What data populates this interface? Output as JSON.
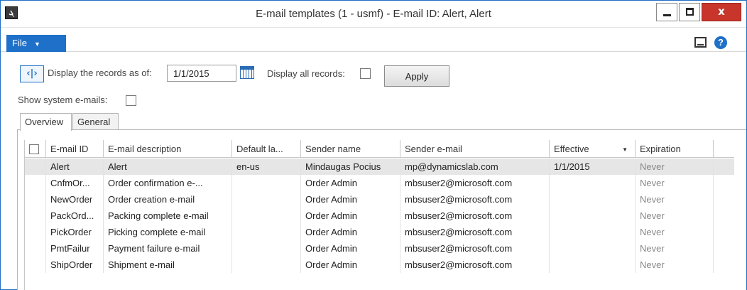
{
  "window": {
    "title": "E-mail templates (1 - usmf) - E-mail ID: Alert, Alert",
    "app_icon_text": "ܓ",
    "close_glyph": "x"
  },
  "ribbon": {
    "file_label": "File",
    "file_caret": "▼",
    "help_glyph": "?"
  },
  "filters": {
    "nav_toggle_glyph": "‹|›",
    "display_as_of_label": "Display the records as of:",
    "display_as_of_value": "1/1/2015",
    "display_all_label": "Display all records:",
    "apply_label": "Apply",
    "show_system_label": "Show system e-mails:"
  },
  "tabs": [
    {
      "label": "Overview",
      "active": true
    },
    {
      "label": "General",
      "active": false
    }
  ],
  "grid": {
    "columns": [
      "E-mail ID",
      "E-mail description",
      "Default la...",
      "Sender name",
      "Sender e-mail",
      "Effective",
      "Expiration"
    ],
    "sorted_column": "Effective",
    "sort_glyph": "▼",
    "rows": [
      {
        "id": "Alert",
        "description": "Alert",
        "language": "en-us",
        "sender_name": "Mindaugas Pocius",
        "sender_email": "mp@dynamicslab.com",
        "effective": "1/1/2015",
        "expiration": "Never",
        "selected": true
      },
      {
        "id": "CnfmOr...",
        "description": "Order confirmation e-...",
        "language": "",
        "sender_name": "Order Admin",
        "sender_email": "mbsuser2@microsoft.com",
        "effective": "",
        "expiration": "Never",
        "selected": false
      },
      {
        "id": "NewOrder",
        "description": "Order creation e-mail",
        "language": "",
        "sender_name": "Order Admin",
        "sender_email": "mbsuser2@microsoft.com",
        "effective": "",
        "expiration": "Never",
        "selected": false
      },
      {
        "id": "PackOrd...",
        "description": "Packing complete e-mail",
        "language": "",
        "sender_name": "Order Admin",
        "sender_email": "mbsuser2@microsoft.com",
        "effective": "",
        "expiration": "Never",
        "selected": false
      },
      {
        "id": "PickOrder",
        "description": "Picking complete e-mail",
        "language": "",
        "sender_name": "Order Admin",
        "sender_email": "mbsuser2@microsoft.com",
        "effective": "",
        "expiration": "Never",
        "selected": false
      },
      {
        "id": "PmtFailur",
        "description": "Payment failure e-mail",
        "language": "",
        "sender_name": "Order Admin",
        "sender_email": "mbsuser2@microsoft.com",
        "effective": "",
        "expiration": "Never",
        "selected": false
      },
      {
        "id": "ShipOrder",
        "description": "Shipment e-mail",
        "language": "",
        "sender_name": "Order Admin",
        "sender_email": "mbsuser2@microsoft.com",
        "effective": "",
        "expiration": "Never",
        "selected": false
      }
    ]
  },
  "colors": {
    "accent": "#1f70c8",
    "close_button": "#c7352b",
    "selected_row": "#e6e6e6",
    "muted_text": "#888888"
  },
  "icons": {
    "app": "dynamics-ax-icon",
    "layout": "layout-icon",
    "help": "help-icon",
    "calendar": "calendar-icon"
  }
}
